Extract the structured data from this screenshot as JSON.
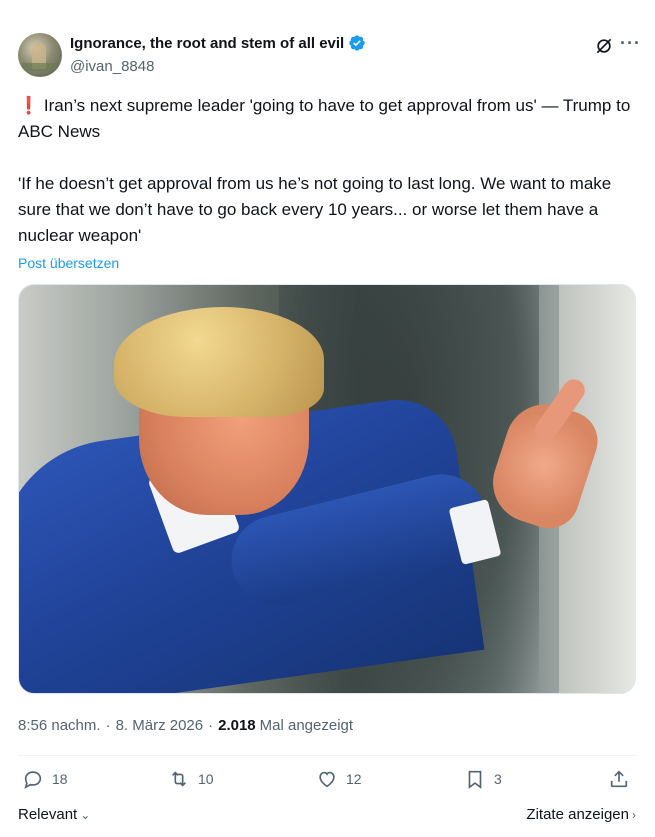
{
  "author": {
    "display_name": "Ignorance, the root and stem of all evil",
    "handle": "@ivan_8848"
  },
  "tweet": {
    "line1_emoji": "❗",
    "line1": "Iran’s next supreme leader 'going to have to get approval from us' — Trump to ABC News",
    "line2": "'If he doesn’t get approval from us he’s not going to last long. We want to make sure that we don’t have to go back every 10 years... or worse let them have a nuclear weapon'",
    "translate_label": "Post übersetzen"
  },
  "meta": {
    "time": "8:56 nachm.",
    "separator": "·",
    "date": "8. März 2026",
    "views_count": "2.018",
    "views_label": "Mal angezeigt"
  },
  "actions": {
    "replies": "18",
    "retweets": "10",
    "likes": "12",
    "bookmarks": "3"
  },
  "footer": {
    "sort_label": "Relevant",
    "quotes_label": "Zitate anzeigen"
  },
  "colors": {
    "accent": "#1d9bf0",
    "verified": "#1d9bf0",
    "secondary_text": "#536471"
  }
}
